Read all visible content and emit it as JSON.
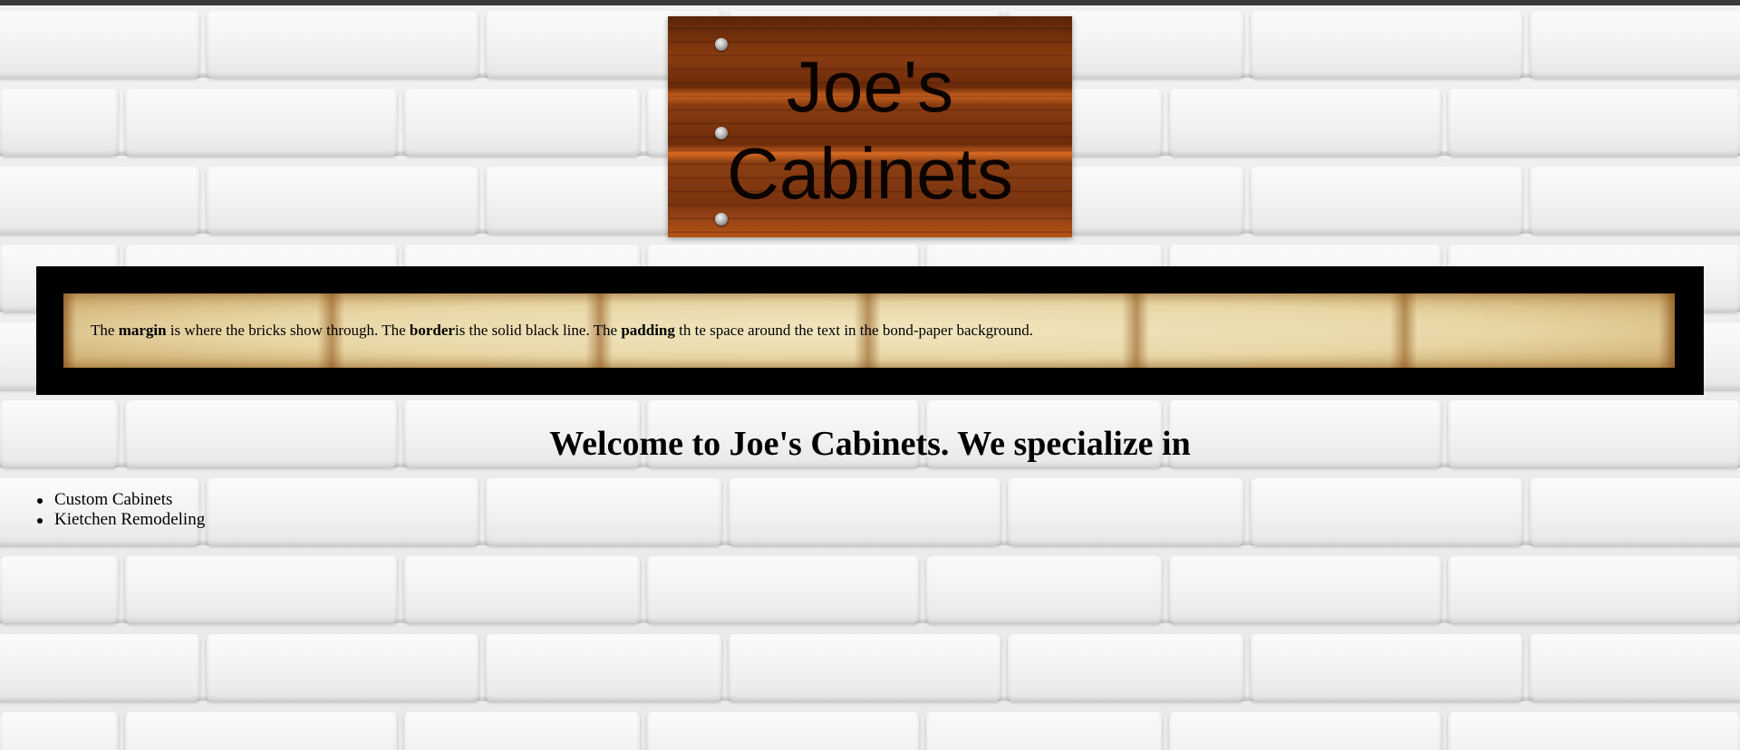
{
  "sign": {
    "title_line1": "Joe's",
    "title_line2": "Cabinets"
  },
  "box": {
    "p1": "The ",
    "b1": "margin",
    "p2": " is where the bricks show through. The ",
    "b2": "border",
    "p3": "is the solid black line. The ",
    "b3": "padding",
    "p4": " th te space around the text in the bond-paper background."
  },
  "welcome": "Welcome to Joe's Cabinets. We specialize in",
  "services": [
    "Custom Cabinets",
    "Kietchen Remodeling"
  ],
  "colors": {
    "wall": "#ececec",
    "border": "#000000",
    "paper": "#e8d7a6",
    "wood": "#8a3c10"
  }
}
